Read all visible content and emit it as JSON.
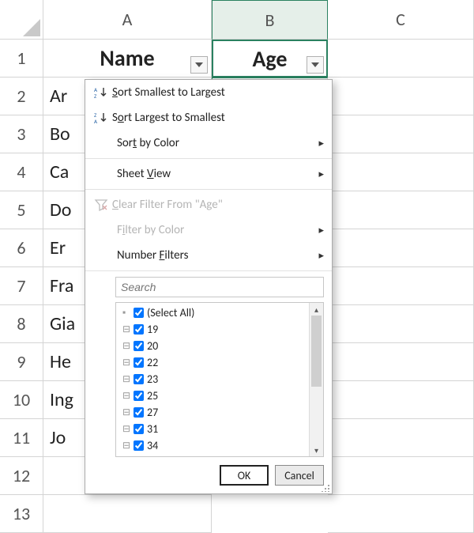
{
  "columns": {
    "A": "A",
    "B": "B",
    "C": "C"
  },
  "headers": {
    "name": "Name",
    "age": "Age"
  },
  "rows": [
    {
      "num": "1"
    },
    {
      "num": "2"
    },
    {
      "num": "3"
    },
    {
      "num": "4"
    },
    {
      "num": "5"
    },
    {
      "num": "6"
    },
    {
      "num": "7"
    },
    {
      "num": "8"
    },
    {
      "num": "9"
    },
    {
      "num": "10"
    },
    {
      "num": "11"
    },
    {
      "num": "12"
    },
    {
      "num": "13"
    }
  ],
  "names": [
    "Ar",
    "Bo",
    "Ca",
    "Do",
    "Er",
    "Fra",
    "Gia",
    "He",
    "Ing",
    "Jo"
  ],
  "menu": {
    "sort_asc": "Sort Smallest to Largest",
    "sort_desc": "Sort Largest to Smallest",
    "sort_color": "Sort by Color",
    "sheet_view": "Sheet View",
    "clear_filter": "Clear Filter From \"Age\"",
    "filter_color": "Filter by Color",
    "number_filters": "Number Filters",
    "search_placeholder": "Search",
    "select_all": "(Select All)",
    "values": [
      "19",
      "20",
      "22",
      "23",
      "25",
      "27",
      "31",
      "34"
    ],
    "ok": "OK",
    "cancel": "Cancel"
  },
  "chart_data": {
    "type": "table",
    "title": "Excel worksheet with AutoFilter dropdown on column Age",
    "columns": [
      "Name",
      "Age"
    ],
    "filter_column": "Age",
    "visible_name_prefixes": [
      "Ar",
      "Bo",
      "Ca",
      "Do",
      "Er",
      "Fra",
      "Gia",
      "He",
      "Ing",
      "Jo"
    ],
    "distinct_age_values_in_filter": [
      19,
      20,
      22,
      23,
      25,
      27,
      31,
      34
    ]
  }
}
